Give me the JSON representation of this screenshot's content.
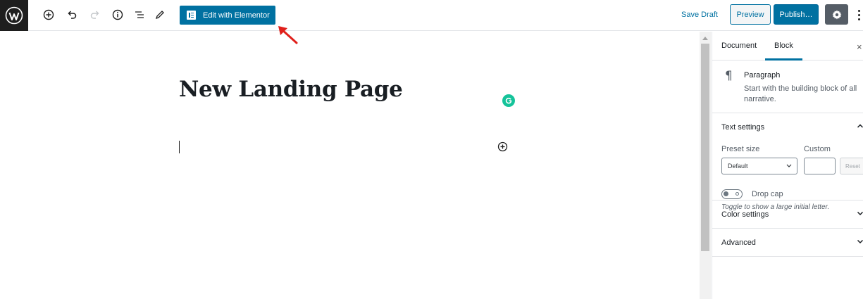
{
  "toolbar": {
    "elementor_label": "Edit with Elementor",
    "save_draft": "Save Draft",
    "preview": "Preview",
    "publish": "Publish…"
  },
  "editor": {
    "title": "New Landing Page"
  },
  "sidebar": {
    "tabs": [
      "Document",
      "Block"
    ],
    "close": "×",
    "block": {
      "name": "Paragraph",
      "description": "Start with the building block of all narrative."
    },
    "text_settings": {
      "title": "Text settings",
      "preset_label": "Preset size",
      "custom_label": "Custom",
      "preset_value": "Default",
      "reset": "Reset",
      "drop_cap": "Drop cap",
      "drop_cap_help": "Toggle to show a large initial letter."
    },
    "panels": {
      "color": "Color settings",
      "advanced": "Advanced"
    }
  },
  "colors": {
    "accent": "#0071a1",
    "grammarly": "#15c39a",
    "arrow": "#e0201b"
  }
}
